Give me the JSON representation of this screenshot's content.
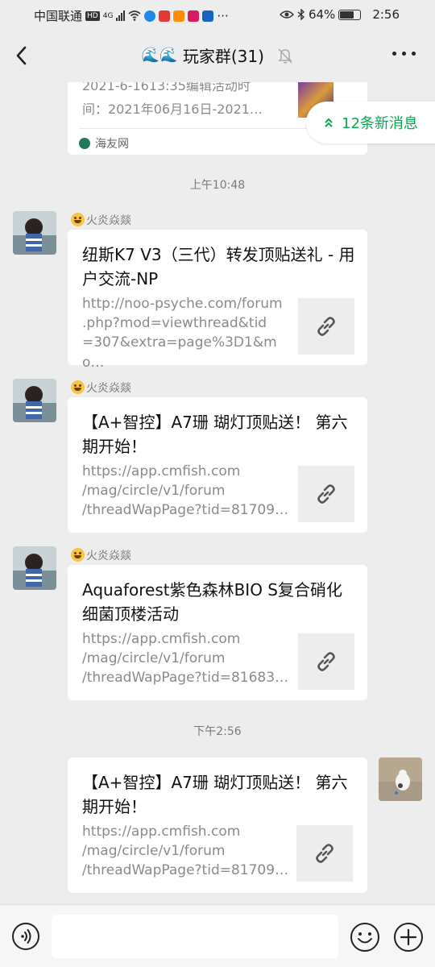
{
  "status_bar": {
    "carrier": "中国联通",
    "hd": "HD",
    "network": "4G",
    "more": "···",
    "battery": "64%",
    "time": "2:56"
  },
  "header": {
    "title": "玩家群(31)",
    "back_icon": "back-arrow-icon",
    "mute_icon": "bell-off-icon",
    "more_icon": "more-dots-icon"
  },
  "new_messages": "12条新消息",
  "previous_card": {
    "text_line1": "2021-6-1613:35编辑活动时",
    "text_line2": "间：2021年06月16日-2021…",
    "source": "海友网"
  },
  "timestamps": {
    "morning": "上午10:48",
    "afternoon": "下午2:56"
  },
  "messages": [
    {
      "sender": "火炎焱燚",
      "title": "纽斯K7 V3（三代）转发顶贴送礼 - 用户交流-NP",
      "desc_lines": [
        "http://noo-psyche.com/forum",
        ".php?mod=viewthread&tid",
        "=307&extra=page%3D1&mo…"
      ]
    },
    {
      "sender": "火炎焱燚",
      "title": "【A+智控】A7珊 瑚灯顶贴送！ 第六期开始！",
      "desc_lines": [
        "https://app.cmfish.com",
        "/mag/circle/v1/forum",
        "/threadWapPage?tid=81709…"
      ]
    },
    {
      "sender": "火炎焱燚",
      "title": "Aquaforest紫色森林BIO S复合硝化细菌顶楼活动",
      "desc_lines": [
        "https://app.cmfish.com",
        "/mag/circle/v1/forum",
        "/threadWapPage?tid=81683…"
      ]
    },
    {
      "sender": "",
      "title": "【A+智控】A7珊 瑚灯顶贴送！ 第六期开始！",
      "desc_lines": [
        "https://app.cmfish.com",
        "/mag/circle/v1/forum",
        "/threadWapPage?tid=81709…"
      ]
    }
  ],
  "input_bar": {
    "voice_icon": "voice-icon",
    "input_value": "",
    "emoji_icon": "emoji-icon",
    "plus_icon": "plus-icon"
  },
  "colors": {
    "background": "#ededed",
    "accent_green": "#07a84f",
    "link_gray": "#8a8a8a"
  }
}
